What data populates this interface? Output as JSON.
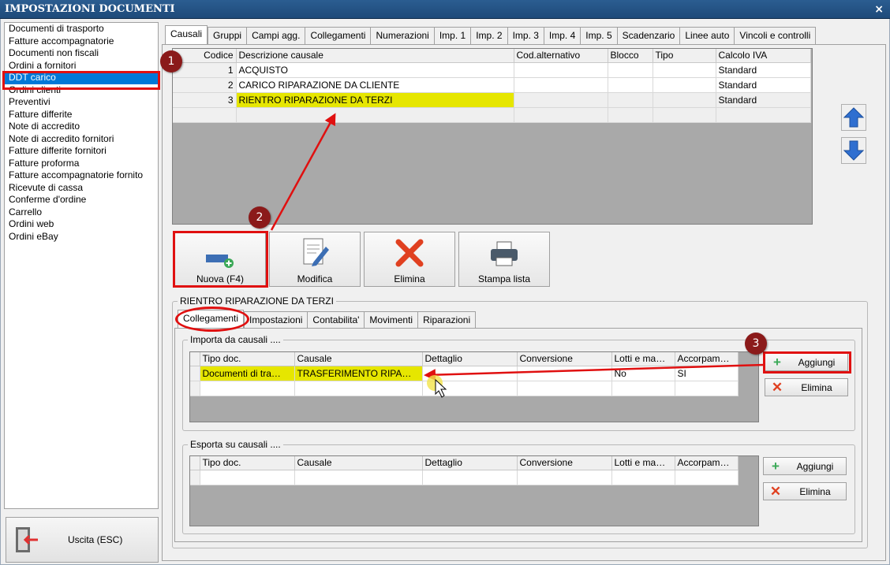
{
  "window": {
    "title": "IMPOSTAZIONI DOCUMENTI",
    "close_glyph": "×"
  },
  "doc_list": [
    "Documenti di trasporto",
    "Fatture accompagnatorie",
    "Documenti non fiscali",
    "Ordini a fornitori",
    "DDT carico",
    "Ordini clienti",
    "Preventivi",
    "Fatture differite",
    "Note di accredito",
    "Note di accredito fornitori",
    "Fatture differite fornitori",
    "Fatture proforma",
    "Fatture accompagnatorie fornito",
    "Ricevute di cassa",
    "Conferme d'ordine",
    "Carrello",
    "Ordini web",
    "Ordini eBay"
  ],
  "doc_list_selected": "DDT carico",
  "exit_button": {
    "label": "Uscita (ESC)",
    "icon": "exit-door-icon"
  },
  "tabs": [
    "Causali",
    "Gruppi",
    "Campi agg.",
    "Collegamenti",
    "Numerazioni",
    "Imp. 1",
    "Imp. 2",
    "Imp. 3",
    "Imp. 4",
    "Imp. 5",
    "Scadenzario",
    "Linee auto",
    "Vincoli e controlli"
  ],
  "active_tab": "Causali",
  "causali_grid": {
    "headers": [
      "Codice",
      "Descrizione causale",
      "Cod.alternativo",
      "Blocco",
      "Tipo",
      "Calcolo IVA"
    ],
    "rows": [
      {
        "codice": "1",
        "descrizione": "ACQUISTO",
        "cod_alt": "",
        "blocco": "",
        "tipo": "",
        "iva": "Standard"
      },
      {
        "codice": "2",
        "descrizione": "CARICO RIPARAZIONE DA CLIENTE",
        "cod_alt": "",
        "blocco": "",
        "tipo": "",
        "iva": "Standard"
      },
      {
        "codice": "3",
        "descrizione": "RIENTRO RIPARAZIONE DA TERZI",
        "cod_alt": "",
        "blocco": "",
        "tipo": "",
        "iva": "Standard"
      }
    ]
  },
  "action_buttons": {
    "nuova": "Nuova (F4)",
    "modifica": "Modifica",
    "elimina": "Elimina",
    "stampa": "Stampa lista"
  },
  "detail_group_title": "RIENTRO RIPARAZIONE DA TERZI",
  "subtabs": [
    "Collegamenti",
    "Impostazioni",
    "Contabilita'",
    "Movimenti",
    "Riparazioni"
  ],
  "active_subtab": "Collegamenti",
  "importa": {
    "title": "Importa da causali ....",
    "headers": [
      "Tipo doc.",
      "Causale",
      "Dettaglio",
      "Conversione",
      "Lotti e ma…",
      "Accorpam…"
    ],
    "rows": [
      {
        "tipo": "Documenti di tra…",
        "causale": "TRASFERIMENTO RIPA…",
        "dettaglio": "",
        "conversione": "",
        "lotti": "No",
        "accorpam": "SI"
      }
    ],
    "add_label": "Aggiungi",
    "delete_label": "Elimina"
  },
  "esporta": {
    "title": "Esporta su causali ....",
    "headers": [
      "Tipo doc.",
      "Causale",
      "Dettaglio",
      "Conversione",
      "Lotti e ma…",
      "Accorpam…"
    ],
    "add_label": "Aggiungi",
    "delete_label": "Elimina"
  },
  "markers": [
    "1",
    "2",
    "3"
  ],
  "colors": {
    "accent_red": "#e01010",
    "highlight": "#e6e600",
    "selection": "#0078d7",
    "title_bar": "#1e4a7a"
  }
}
